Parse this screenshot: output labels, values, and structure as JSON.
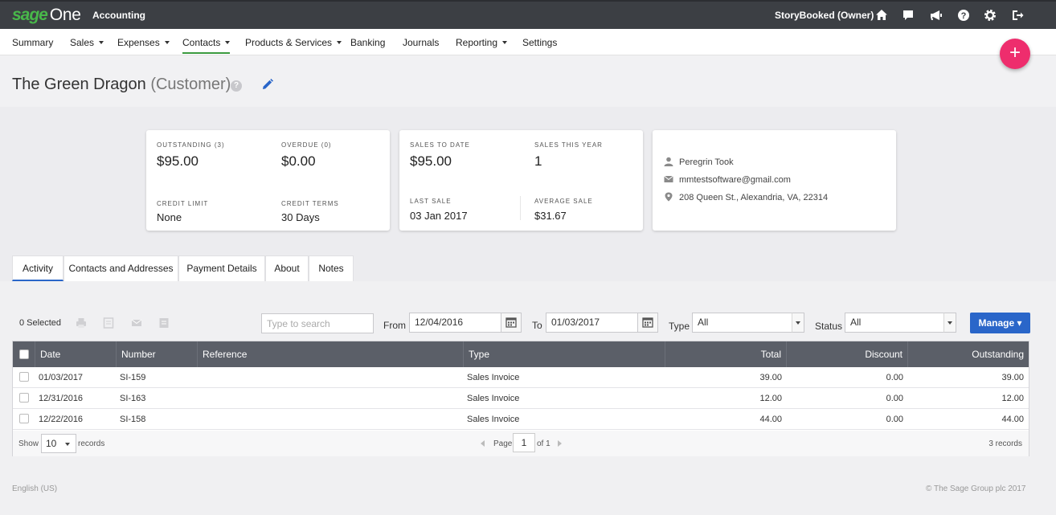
{
  "app": {
    "brand_sage": "sage",
    "brand_one": "One",
    "module": "Accounting",
    "user": "StoryBooked (Owner)",
    "icons": [
      "home-icon",
      "messages-icon",
      "announcements-icon",
      "help-icon",
      "settings-icon",
      "logout-icon"
    ]
  },
  "nav": {
    "items": [
      {
        "label": "Summary"
      },
      {
        "label": "Sales"
      },
      {
        "label": "Expenses"
      },
      {
        "label": "Contacts"
      },
      {
        "label": "Products & Services"
      },
      {
        "label": "Banking"
      },
      {
        "label": "Journals"
      },
      {
        "label": "Reporting"
      },
      {
        "label": "Settings"
      }
    ],
    "active": "Contacts"
  },
  "fab": {
    "label": "+"
  },
  "header": {
    "name": "The Green Dragon",
    "role": "(Customer)",
    "help_glyph": "?"
  },
  "summary": {
    "outstanding_label": "OUTSTANDING (3)",
    "outstanding_value": "$95.00",
    "overdue_label": "OVERDUE (0)",
    "overdue_value": "$0.00",
    "credit_limit_label": "CREDIT LIMIT",
    "credit_limit_value": "None",
    "credit_terms_label": "CREDIT TERMS",
    "credit_terms_value": "30 Days",
    "sales_to_date_label": "SALES TO DATE",
    "sales_to_date_value": "$95.00",
    "sales_this_year_label": "SALES THIS YEAR",
    "sales_this_year_value": "1",
    "last_sale_label": "LAST SALE",
    "last_sale_value": "03 Jan 2017",
    "average_sale_label": "AVERAGE SALE",
    "average_sale_value": "$31.67"
  },
  "contact": {
    "name": "Peregrin Took",
    "email": "mmtestsoftware@gmail.com",
    "address": "208 Queen St., Alexandria, VA, 22314"
  },
  "tabs": [
    {
      "label": "Activity"
    },
    {
      "label": "Contacts and Addresses"
    },
    {
      "label": "Payment Details"
    },
    {
      "label": "About"
    },
    {
      "label": "Notes"
    }
  ],
  "toolbar": {
    "selected": "0 Selected",
    "search_placeholder": "Type to search",
    "from_label": "From",
    "from_value": "12/04/2016",
    "to_label": "To",
    "to_value": "01/03/2017",
    "type_label": "Type",
    "type_value": "All",
    "status_label": "Status",
    "status_value": "All",
    "manage_label": "Manage ▾"
  },
  "table": {
    "columns": [
      "Date",
      "Number",
      "Reference",
      "Type",
      "Total",
      "Discount",
      "Outstanding"
    ],
    "rows": [
      {
        "date": "01/03/2017",
        "number": "SI-159",
        "reference": "",
        "type": "Sales Invoice",
        "total": "39.00",
        "discount": "0.00",
        "outstanding": "39.00"
      },
      {
        "date": "12/31/2016",
        "number": "SI-163",
        "reference": "",
        "type": "Sales Invoice",
        "total": "12.00",
        "discount": "0.00",
        "outstanding": "12.00"
      },
      {
        "date": "12/22/2016",
        "number": "SI-158",
        "reference": "",
        "type": "Sales Invoice",
        "total": "44.00",
        "discount": "0.00",
        "outstanding": "44.00"
      }
    ],
    "show_label": "Show",
    "page_size": "10",
    "records_label": "records",
    "page_label": "Page",
    "page_value": "1",
    "of_label": "of 1",
    "record_count": "3 records"
  },
  "footer": {
    "language": "English (US)",
    "copyright": "© The Sage Group plc 2017"
  }
}
